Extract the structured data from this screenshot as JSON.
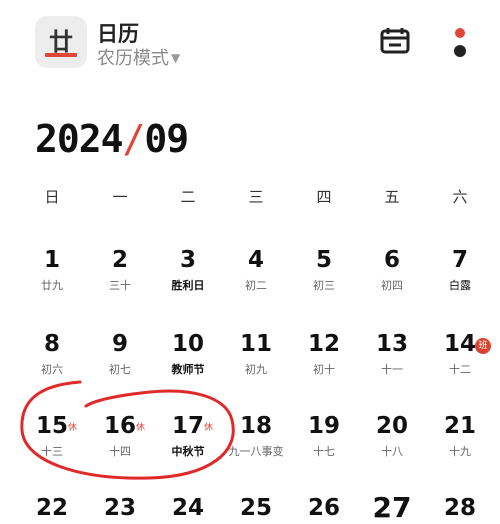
{
  "app": {
    "icon_glyph": "廿",
    "title": "日历",
    "mode": "农历模式",
    "mode_caret": "▼"
  },
  "toolbar": {
    "calendar_icon": "calendar-icon",
    "more_icon": "more-icon"
  },
  "month": {
    "year": "2024",
    "separator": "/",
    "month": "09"
  },
  "weekdays": [
    "日",
    "一",
    "二",
    "三",
    "四",
    "五",
    "六"
  ],
  "weeks": [
    [
      {
        "d": "1",
        "sub": "廿九"
      },
      {
        "d": "2",
        "sub": "三十"
      },
      {
        "d": "3",
        "sub": "胜利日"
      },
      {
        "d": "4",
        "sub": "初二"
      },
      {
        "d": "5",
        "sub": "初三"
      },
      {
        "d": "6",
        "sub": "初四"
      },
      {
        "d": "7",
        "sub": "白露"
      }
    ],
    [
      {
        "d": "8",
        "sub": "初六"
      },
      {
        "d": "9",
        "sub": "初七"
      },
      {
        "d": "10",
        "sub": "教师节"
      },
      {
        "d": "11",
        "sub": "初九"
      },
      {
        "d": "12",
        "sub": "初十"
      },
      {
        "d": "13",
        "sub": "十一"
      },
      {
        "d": "14",
        "sub": "十二",
        "badge": "班"
      }
    ],
    [
      {
        "d": "15",
        "sub": "十三",
        "rest": "休"
      },
      {
        "d": "16",
        "sub": "十四",
        "rest": "休"
      },
      {
        "d": "17",
        "sub": "中秋节",
        "rest": "休"
      },
      {
        "d": "18",
        "sub": "九一八事变"
      },
      {
        "d": "19",
        "sub": "十七"
      },
      {
        "d": "20",
        "sub": "十八"
      },
      {
        "d": "21",
        "sub": "十九"
      }
    ],
    [
      {
        "d": "22"
      },
      {
        "d": "23"
      },
      {
        "d": "24"
      },
      {
        "d": "25"
      },
      {
        "d": "26"
      },
      {
        "d": "27"
      },
      {
        "d": "28"
      }
    ]
  ],
  "colors": {
    "accent": "#e0453a",
    "circle": "#e02a2a"
  }
}
